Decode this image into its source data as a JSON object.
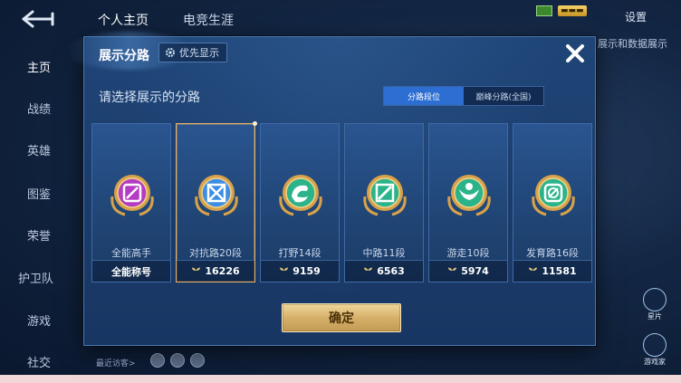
{
  "topbar": {
    "tab_profile": "个人主页",
    "tab_esports": "电竞生涯",
    "settings": "设置",
    "peek_text": "展示和数据展示"
  },
  "sidenav": [
    {
      "label": "主页",
      "active": true
    },
    {
      "label": "战绩"
    },
    {
      "label": "英雄"
    },
    {
      "label": "图鉴"
    },
    {
      "label": "荣誉"
    },
    {
      "label": "护卫队"
    },
    {
      "label": "游戏"
    },
    {
      "label": "社交"
    }
  ],
  "bottom": {
    "recent": "最近访客>"
  },
  "right_tools": {
    "tool1": "星片",
    "tool2": "游戏家"
  },
  "dialog": {
    "title": "展示分路",
    "priority_label": "优先显示",
    "subtitle": "请选择展示的分路",
    "segments": [
      "分路段位",
      "巅峰分路(全国)"
    ],
    "active_segment": 0,
    "confirm_label": "确定",
    "cards": [
      {
        "name": "全能高手",
        "value": "全能称号",
        "show_icon": false,
        "color": "#b43cc4",
        "selected": false
      },
      {
        "name": "对抗路20段",
        "value": "16226",
        "show_icon": true,
        "color": "#3a8ee6",
        "selected": true
      },
      {
        "name": "打野14段",
        "value": "9159",
        "show_icon": true,
        "color": "#2bb48a",
        "selected": false
      },
      {
        "name": "中路11段",
        "value": "6563",
        "show_icon": true,
        "color": "#2bb48a",
        "selected": false
      },
      {
        "name": "游走10段",
        "value": "5974",
        "show_icon": true,
        "color": "#2bb48a",
        "selected": false
      },
      {
        "name": "发育路16段",
        "value": "11581",
        "show_icon": true,
        "color": "#2bb48a",
        "selected": false
      }
    ]
  },
  "colors": {
    "accent": "#2c6ed1",
    "gold": "#e7b267",
    "confirm": "#d6b06a"
  }
}
